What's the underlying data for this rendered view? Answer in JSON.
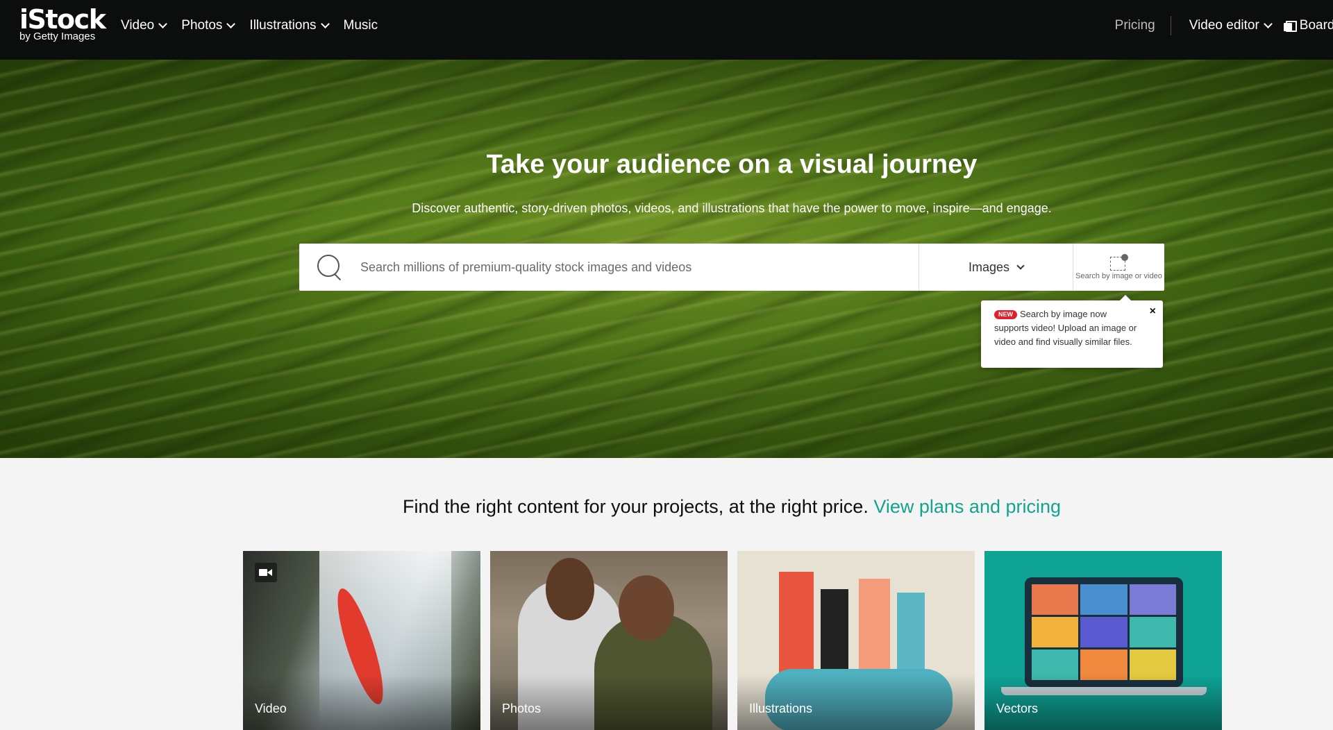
{
  "header": {
    "logo_main": "iStock",
    "logo_sub": "by Getty Images",
    "nav": [
      {
        "label": "Video"
      },
      {
        "label": "Photos"
      },
      {
        "label": "Illustrations"
      },
      {
        "label": "Music"
      }
    ],
    "pricing": "Pricing",
    "video_editor": "Video editor",
    "boards": "Boards"
  },
  "hero": {
    "title": "Take your audience on a visual journey",
    "subtitle": "Discover authentic, story-driven photos, videos, and illustrations that have the power to move, inspire—and engage.",
    "search": {
      "placeholder": "Search millions of premium-quality stock images and videos",
      "type_selected": "Images",
      "image_search_label": "Search by image or video"
    },
    "tooltip": {
      "badge": "NEW",
      "text": "Search by image now supports video! Upload an image or video and find visually similar files.",
      "close": "×"
    }
  },
  "tagline": {
    "text": "Find the right content for your projects, at the right price.",
    "link": "View plans and pricing"
  },
  "cards": [
    {
      "label": "Video"
    },
    {
      "label": "Photos"
    },
    {
      "label": "Illustrations"
    },
    {
      "label": "Vectors"
    }
  ],
  "colors": {
    "header_bg": "#0c0d0d",
    "accent_link": "#14a38b",
    "new_badge": "#e0202b"
  }
}
